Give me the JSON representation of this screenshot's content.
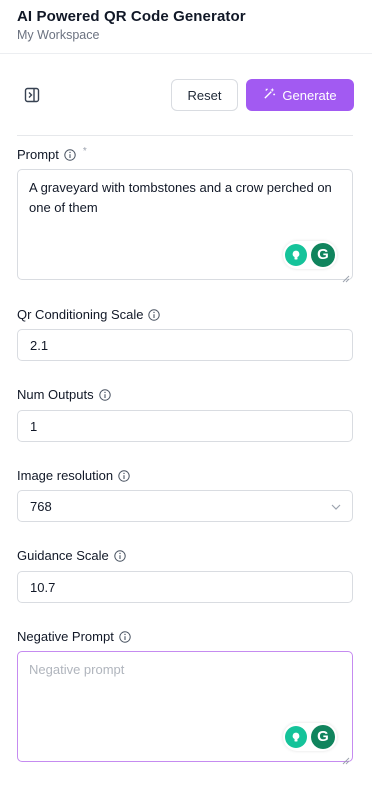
{
  "header": {
    "title": "AI Powered QR Code Generator",
    "workspace": "My Workspace"
  },
  "toolbar": {
    "reset_label": "Reset",
    "generate_label": "Generate"
  },
  "form": {
    "prompt": {
      "label": "Prompt",
      "required_mark": "*",
      "value": "A graveyard with tombstones and a crow perched on one of them"
    },
    "qr_scale": {
      "label": "Qr Conditioning Scale",
      "value": "2.1"
    },
    "num_outputs": {
      "label": "Num Outputs",
      "value": "1"
    },
    "resolution": {
      "label": "Image resolution",
      "value": "768"
    },
    "guidance": {
      "label": "Guidance Scale",
      "value": "10.7"
    },
    "negative": {
      "label": "Negative Prompt",
      "placeholder": "Negative prompt",
      "value": ""
    }
  },
  "grammarly": {
    "letter": "G"
  },
  "colors": {
    "accent": "#a25af2",
    "grammarly_green": "#10845d",
    "grammarly_light": "#15c39a"
  }
}
